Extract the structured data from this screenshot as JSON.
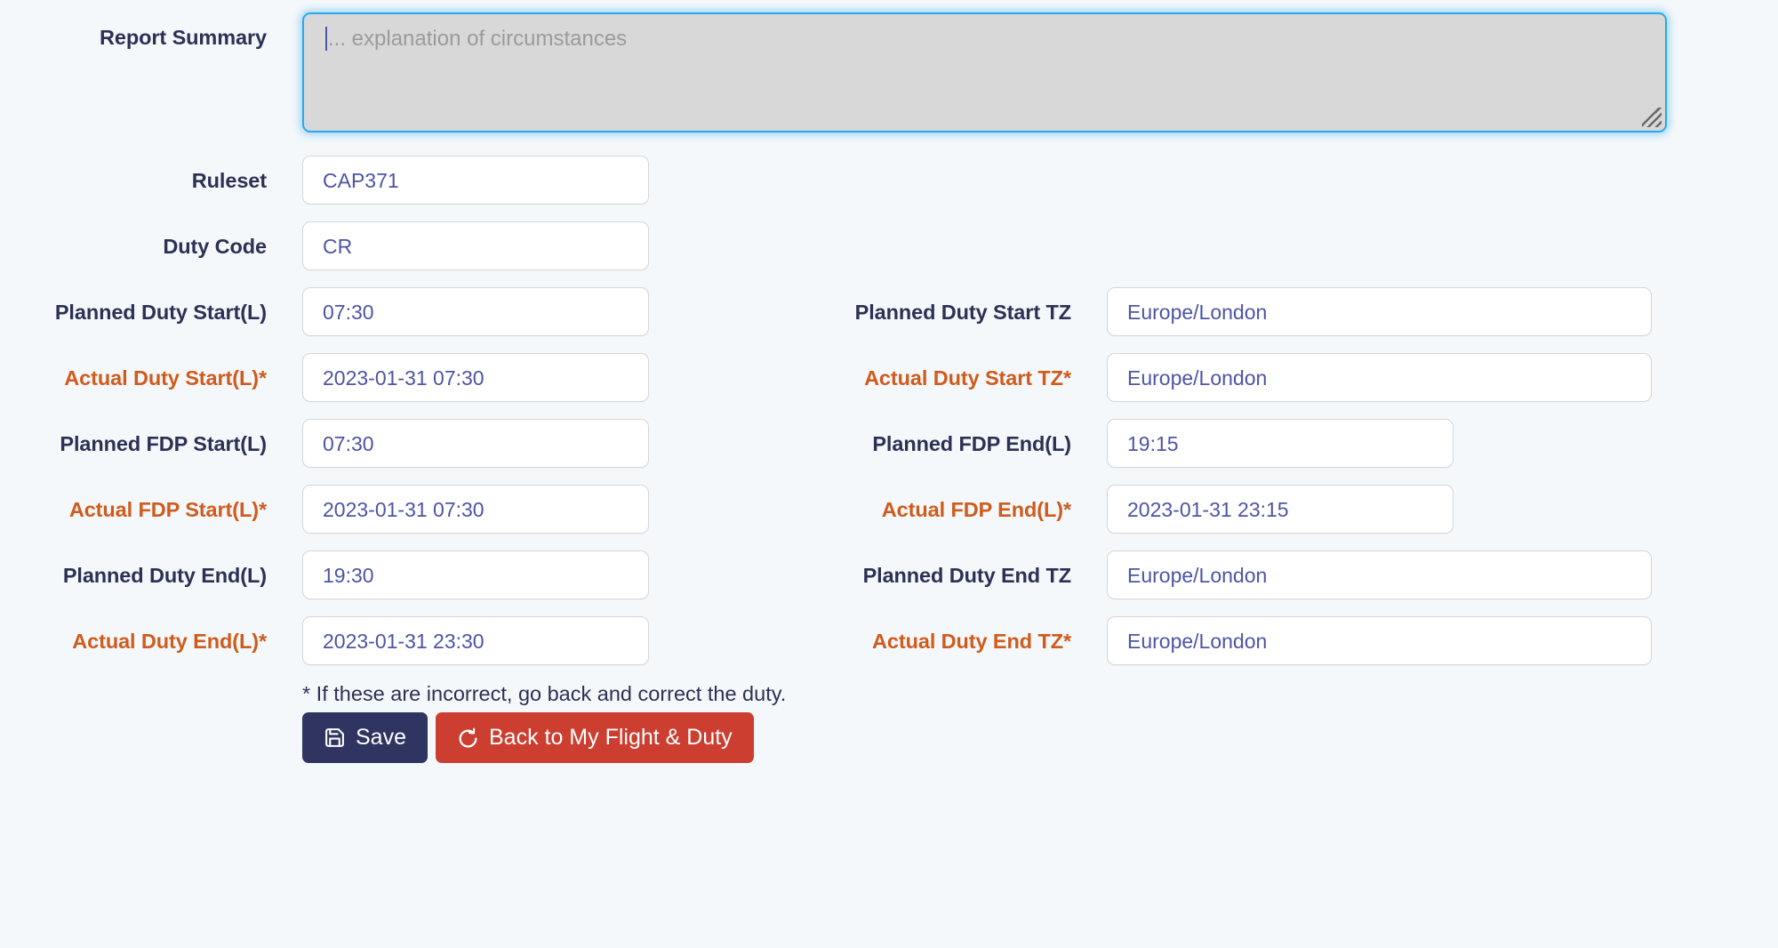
{
  "report_summary": {
    "label": "Report Summary",
    "placeholder": "... explanation of circumstances",
    "value": ""
  },
  "fields": {
    "ruleset": {
      "label": "Ruleset",
      "value": "CAP371"
    },
    "duty_code": {
      "label": "Duty Code",
      "value": "CR"
    },
    "planned_duty_start": {
      "label": "Planned Duty Start(L)",
      "value": "07:30"
    },
    "planned_duty_start_tz": {
      "label": "Planned Duty Start TZ",
      "value": "Europe/London"
    },
    "actual_duty_start": {
      "label": "Actual Duty Start(L)*",
      "value": "2023-01-31 07:30"
    },
    "actual_duty_start_tz": {
      "label": "Actual Duty Start TZ*",
      "value": "Europe/London"
    },
    "planned_fdp_start": {
      "label": "Planned FDP Start(L)",
      "value": "07:30"
    },
    "planned_fdp_end": {
      "label": "Planned FDP End(L)",
      "value": "19:15"
    },
    "actual_fdp_start": {
      "label": "Actual FDP Start(L)*",
      "value": "2023-01-31 07:30"
    },
    "actual_fdp_end": {
      "label": "Actual FDP End(L)*",
      "value": "2023-01-31 23:15"
    },
    "planned_duty_end": {
      "label": "Planned Duty End(L)",
      "value": "19:30"
    },
    "planned_duty_end_tz": {
      "label": "Planned Duty End TZ",
      "value": "Europe/London"
    },
    "actual_duty_end": {
      "label": "Actual Duty End(L)*",
      "value": "2023-01-31 23:30"
    },
    "actual_duty_end_tz": {
      "label": "Actual Duty End TZ*",
      "value": "Europe/London"
    }
  },
  "footer": {
    "note": "* If these are incorrect, go back and correct the duty.",
    "save_label": "Save",
    "back_label": "Back to My Flight & Duty",
    "save_icon": "floppy-disk-icon",
    "back_icon": "undo-arrow-icon"
  },
  "colors": {
    "page_background": "#f4f8fb",
    "label": "#2c3154",
    "label_required": "#cf5b1c",
    "input_text": "#4e54a5",
    "input_border": "#d3d6db",
    "focus_border": "#2aa8ee",
    "save_button": "#2f3460",
    "back_button": "#cc3e30"
  }
}
